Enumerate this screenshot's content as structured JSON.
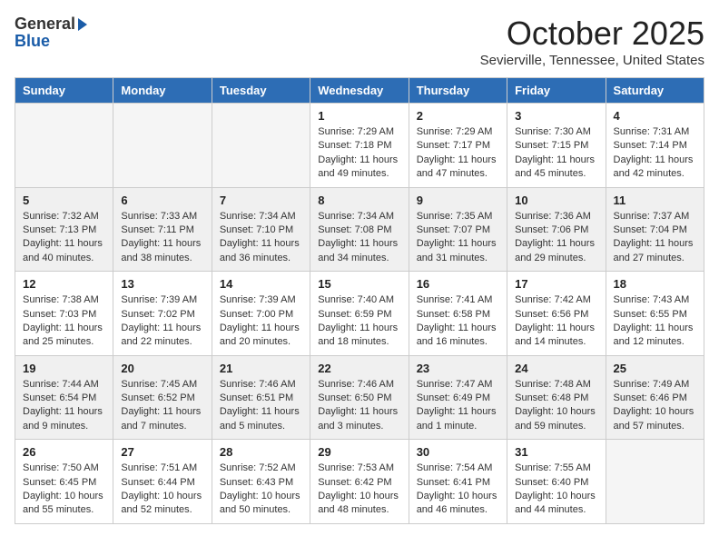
{
  "header": {
    "logo_general": "General",
    "logo_blue": "Blue",
    "month_title": "October 2025",
    "location": "Sevierville, Tennessee, United States"
  },
  "weekdays": [
    "Sunday",
    "Monday",
    "Tuesday",
    "Wednesday",
    "Thursday",
    "Friday",
    "Saturday"
  ],
  "weeks": [
    [
      {
        "day": "",
        "info": ""
      },
      {
        "day": "",
        "info": ""
      },
      {
        "day": "",
        "info": ""
      },
      {
        "day": "1",
        "info": "Sunrise: 7:29 AM\nSunset: 7:18 PM\nDaylight: 11 hours and 49 minutes."
      },
      {
        "day": "2",
        "info": "Sunrise: 7:29 AM\nSunset: 7:17 PM\nDaylight: 11 hours and 47 minutes."
      },
      {
        "day": "3",
        "info": "Sunrise: 7:30 AM\nSunset: 7:15 PM\nDaylight: 11 hours and 45 minutes."
      },
      {
        "day": "4",
        "info": "Sunrise: 7:31 AM\nSunset: 7:14 PM\nDaylight: 11 hours and 42 minutes."
      }
    ],
    [
      {
        "day": "5",
        "info": "Sunrise: 7:32 AM\nSunset: 7:13 PM\nDaylight: 11 hours and 40 minutes."
      },
      {
        "day": "6",
        "info": "Sunrise: 7:33 AM\nSunset: 7:11 PM\nDaylight: 11 hours and 38 minutes."
      },
      {
        "day": "7",
        "info": "Sunrise: 7:34 AM\nSunset: 7:10 PM\nDaylight: 11 hours and 36 minutes."
      },
      {
        "day": "8",
        "info": "Sunrise: 7:34 AM\nSunset: 7:08 PM\nDaylight: 11 hours and 34 minutes."
      },
      {
        "day": "9",
        "info": "Sunrise: 7:35 AM\nSunset: 7:07 PM\nDaylight: 11 hours and 31 minutes."
      },
      {
        "day": "10",
        "info": "Sunrise: 7:36 AM\nSunset: 7:06 PM\nDaylight: 11 hours and 29 minutes."
      },
      {
        "day": "11",
        "info": "Sunrise: 7:37 AM\nSunset: 7:04 PM\nDaylight: 11 hours and 27 minutes."
      }
    ],
    [
      {
        "day": "12",
        "info": "Sunrise: 7:38 AM\nSunset: 7:03 PM\nDaylight: 11 hours and 25 minutes."
      },
      {
        "day": "13",
        "info": "Sunrise: 7:39 AM\nSunset: 7:02 PM\nDaylight: 11 hours and 22 minutes."
      },
      {
        "day": "14",
        "info": "Sunrise: 7:39 AM\nSunset: 7:00 PM\nDaylight: 11 hours and 20 minutes."
      },
      {
        "day": "15",
        "info": "Sunrise: 7:40 AM\nSunset: 6:59 PM\nDaylight: 11 hours and 18 minutes."
      },
      {
        "day": "16",
        "info": "Sunrise: 7:41 AM\nSunset: 6:58 PM\nDaylight: 11 hours and 16 minutes."
      },
      {
        "day": "17",
        "info": "Sunrise: 7:42 AM\nSunset: 6:56 PM\nDaylight: 11 hours and 14 minutes."
      },
      {
        "day": "18",
        "info": "Sunrise: 7:43 AM\nSunset: 6:55 PM\nDaylight: 11 hours and 12 minutes."
      }
    ],
    [
      {
        "day": "19",
        "info": "Sunrise: 7:44 AM\nSunset: 6:54 PM\nDaylight: 11 hours and 9 minutes."
      },
      {
        "day": "20",
        "info": "Sunrise: 7:45 AM\nSunset: 6:52 PM\nDaylight: 11 hours and 7 minutes."
      },
      {
        "day": "21",
        "info": "Sunrise: 7:46 AM\nSunset: 6:51 PM\nDaylight: 11 hours and 5 minutes."
      },
      {
        "day": "22",
        "info": "Sunrise: 7:46 AM\nSunset: 6:50 PM\nDaylight: 11 hours and 3 minutes."
      },
      {
        "day": "23",
        "info": "Sunrise: 7:47 AM\nSunset: 6:49 PM\nDaylight: 11 hours and 1 minute."
      },
      {
        "day": "24",
        "info": "Sunrise: 7:48 AM\nSunset: 6:48 PM\nDaylight: 10 hours and 59 minutes."
      },
      {
        "day": "25",
        "info": "Sunrise: 7:49 AM\nSunset: 6:46 PM\nDaylight: 10 hours and 57 minutes."
      }
    ],
    [
      {
        "day": "26",
        "info": "Sunrise: 7:50 AM\nSunset: 6:45 PM\nDaylight: 10 hours and 55 minutes."
      },
      {
        "day": "27",
        "info": "Sunrise: 7:51 AM\nSunset: 6:44 PM\nDaylight: 10 hours and 52 minutes."
      },
      {
        "day": "28",
        "info": "Sunrise: 7:52 AM\nSunset: 6:43 PM\nDaylight: 10 hours and 50 minutes."
      },
      {
        "day": "29",
        "info": "Sunrise: 7:53 AM\nSunset: 6:42 PM\nDaylight: 10 hours and 48 minutes."
      },
      {
        "day": "30",
        "info": "Sunrise: 7:54 AM\nSunset: 6:41 PM\nDaylight: 10 hours and 46 minutes."
      },
      {
        "day": "31",
        "info": "Sunrise: 7:55 AM\nSunset: 6:40 PM\nDaylight: 10 hours and 44 minutes."
      },
      {
        "day": "",
        "info": ""
      }
    ]
  ]
}
